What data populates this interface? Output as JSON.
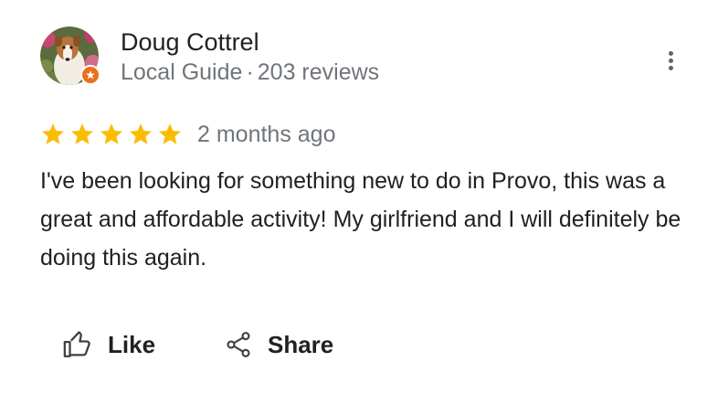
{
  "reviewer": {
    "name": "Doug Cottrel",
    "badge": "Local Guide",
    "separator": "·",
    "review_count": "203 reviews",
    "badge_color": "#e8711a"
  },
  "menu": {
    "icon": "more-vert-icon"
  },
  "review": {
    "rating": 5,
    "max_rating": 5,
    "star_color": "#fbbc04",
    "time_ago": "2 months ago",
    "text": "I've been looking for something new to do in Provo, this was a great and affordable activity! My girlfriend and I will definitely be doing this again."
  },
  "actions": {
    "like_label": "Like",
    "like_icon": "thumbs-up-icon",
    "share_label": "Share",
    "share_icon": "share-icon"
  }
}
